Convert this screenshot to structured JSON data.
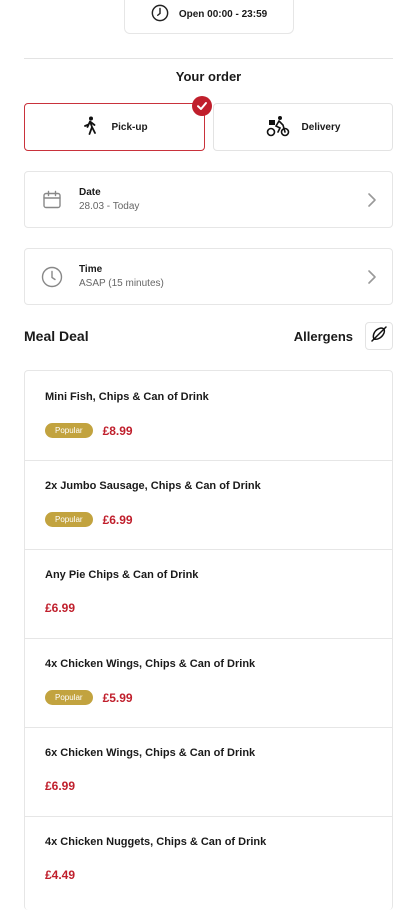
{
  "header": {
    "hours_text": "Open 00:00 - 23:59",
    "hours_icon": "clock-icon"
  },
  "order": {
    "title": "Your order"
  },
  "modes": [
    {
      "label": "Pick-up",
      "icon": "walking-person-icon",
      "selected": true
    },
    {
      "label": "Delivery",
      "icon": "bicycle-courier-icon",
      "selected": false
    }
  ],
  "date_row": {
    "label": "Date",
    "value": "28.03 - Today",
    "icon": "calendar-icon"
  },
  "time_row": {
    "label": "Time",
    "value": "ASAP (15 minutes)",
    "icon": "clock-icon"
  },
  "menu": {
    "category": "Meal Deal",
    "allergens_label": "Allergens",
    "items": [
      {
        "name": "Mini Fish, Chips & Can of Drink",
        "badge": "Popular",
        "price": "£8.99"
      },
      {
        "name": "2x Jumbo Sausage, Chips & Can of Drink",
        "badge": "Popular",
        "price": "£6.99"
      },
      {
        "name": "Any Pie Chips & Can of Drink",
        "badge": "",
        "price": "£6.99"
      },
      {
        "name": "4x Chicken Wings, Chips & Can of Drink",
        "badge": "Popular",
        "price": "£5.99"
      },
      {
        "name": "6x Chicken Wings, Chips & Can of Drink",
        "badge": "",
        "price": "£6.99"
      },
      {
        "name": "4x Chicken Nuggets, Chips & Can of Drink",
        "badge": "",
        "price": "£4.49"
      }
    ]
  },
  "colors": {
    "accent": "#c01f2c",
    "badge": "#c2a33f",
    "border": "#e6e6e6"
  }
}
